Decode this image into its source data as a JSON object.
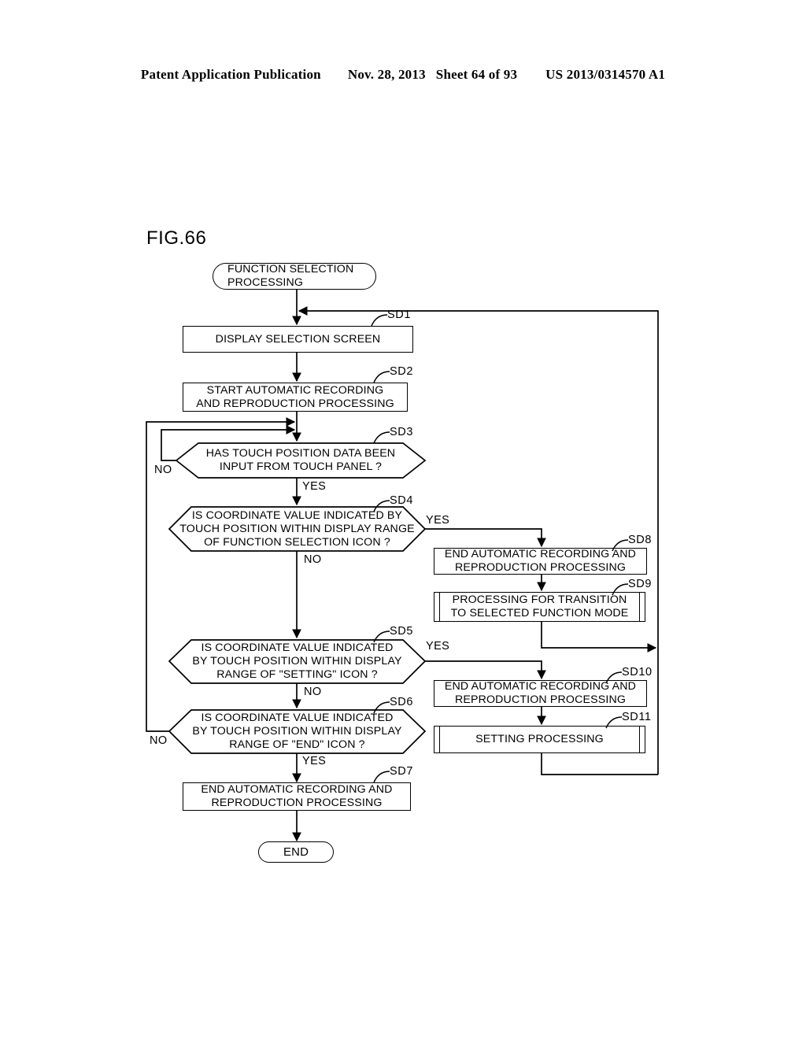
{
  "header": {
    "publication": "Patent Application Publication",
    "date": "Nov. 28, 2013",
    "sheet": "Sheet 64 of 93",
    "patent_number": "US 2013/0314570 A1"
  },
  "figure": {
    "title": "FIG.66"
  },
  "nodes": {
    "start": {
      "id": "",
      "shape": "terminator",
      "lines": [
        "FUNCTION SELECTION",
        "PROCESSING"
      ]
    },
    "sd1": {
      "id": "SD1",
      "shape": "process",
      "lines": [
        "DISPLAY SELECTION SCREEN"
      ]
    },
    "sd2": {
      "id": "SD2",
      "shape": "process",
      "lines": [
        "START AUTOMATIC RECORDING",
        "AND REPRODUCTION PROCESSING"
      ]
    },
    "sd3": {
      "id": "SD3",
      "shape": "decision",
      "lines": [
        "HAS TOUCH POSITION DATA BEEN",
        "INPUT FROM TOUCH PANEL ?"
      ]
    },
    "sd4": {
      "id": "SD4",
      "shape": "decision",
      "lines": [
        "IS COORDINATE VALUE INDICATED BY",
        "TOUCH POSITION WITHIN DISPLAY RANGE",
        "OF FUNCTION SELECTION ICON ?"
      ]
    },
    "sd5": {
      "id": "SD5",
      "shape": "decision",
      "lines": [
        "IS COORDINATE VALUE INDICATED",
        "BY TOUCH POSITION WITHIN DISPLAY",
        "RANGE OF \"SETTING\" ICON ?"
      ]
    },
    "sd6": {
      "id": "SD6",
      "shape": "decision",
      "lines": [
        "IS COORDINATE VALUE INDICATED",
        "BY TOUCH POSITION WITHIN DISPLAY",
        "RANGE OF \"END\" ICON ?"
      ]
    },
    "sd7": {
      "id": "SD7",
      "shape": "process",
      "lines": [
        "END AUTOMATIC RECORDING AND",
        "REPRODUCTION PROCESSING"
      ]
    },
    "sd8": {
      "id": "SD8",
      "shape": "process",
      "lines": [
        "END AUTOMATIC RECORDING AND",
        "REPRODUCTION PROCESSING"
      ]
    },
    "sd9": {
      "id": "SD9",
      "shape": "predefined-process",
      "lines": [
        "PROCESSING FOR TRANSITION",
        "TO SELECTED FUNCTION MODE"
      ]
    },
    "sd10": {
      "id": "SD10",
      "shape": "process",
      "lines": [
        "END AUTOMATIC RECORDING AND",
        "REPRODUCTION PROCESSING"
      ]
    },
    "sd11": {
      "id": "SD11",
      "shape": "predefined-process",
      "lines": [
        "SETTING PROCESSING"
      ]
    },
    "end": {
      "id": "",
      "shape": "terminator",
      "lines": [
        "END"
      ]
    }
  },
  "branch_labels": {
    "sd3_no": "NO",
    "sd3_yes": "YES",
    "sd4_yes": "YES",
    "sd4_no": "NO",
    "sd5_yes": "YES",
    "sd5_no": "NO",
    "sd6_no": "NO",
    "sd6_yes": "YES"
  },
  "colors": {
    "ink": "#000000",
    "paper": "#ffffff"
  }
}
